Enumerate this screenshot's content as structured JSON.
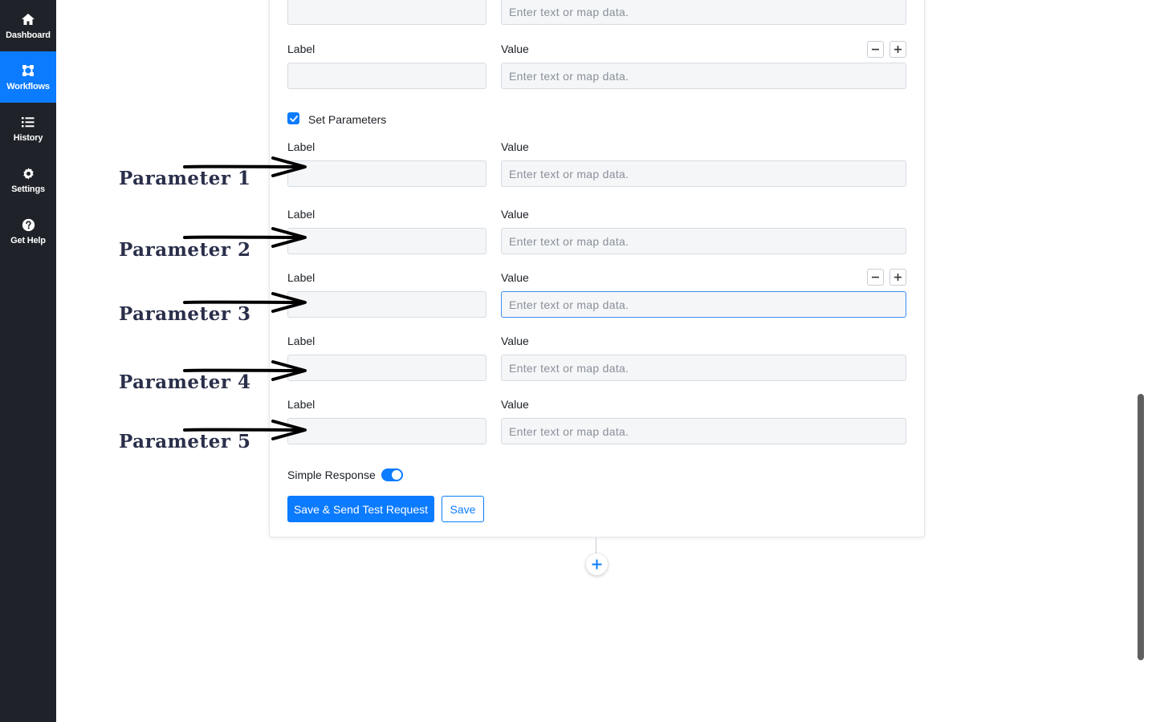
{
  "sidebar": {
    "items": [
      {
        "label": "Dashboard",
        "icon": "home-icon",
        "active": false
      },
      {
        "label": "Workflows",
        "icon": "workflows-icon",
        "active": true
      },
      {
        "label": "History",
        "icon": "list-icon",
        "active": false
      },
      {
        "label": "Settings",
        "icon": "gear-icon",
        "active": false
      },
      {
        "label": "Get Help",
        "icon": "question-icon",
        "active": false
      }
    ]
  },
  "form": {
    "value_placeholder": "Enter text or map data.",
    "label_text": "Label",
    "value_text": "Value",
    "set_parameters_label": "Set Parameters",
    "set_parameters_checked": true,
    "simple_response_label": "Simple Response",
    "simple_response_on": true,
    "save_send_label": "Save & Send Test Request",
    "save_label": "Save"
  },
  "annotations": {
    "items": [
      "Parameter 1",
      "Parameter 2",
      "Parameter 3",
      "Parameter 4",
      "Parameter 5"
    ]
  },
  "colors": {
    "sidebar_bg": "#1f2329",
    "accent": "#0b7bff",
    "input_bg": "#f4f6f8"
  }
}
